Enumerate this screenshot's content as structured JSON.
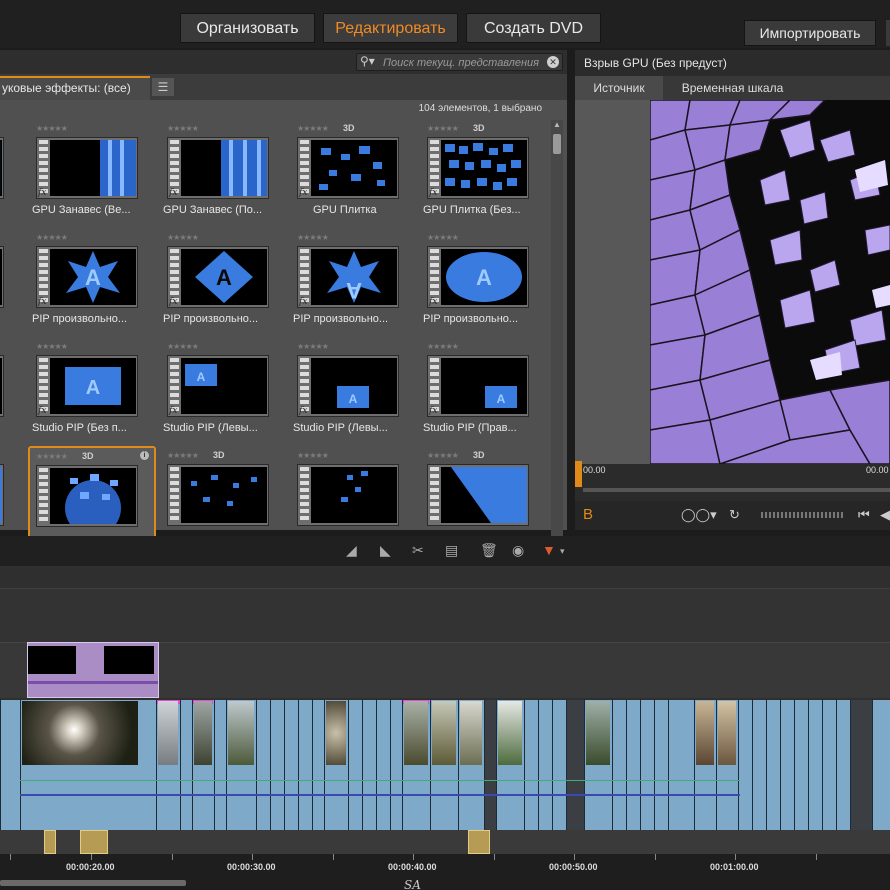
{
  "modes": [
    {
      "label": "Организовать"
    },
    {
      "label": "Редактировать"
    },
    {
      "label": "Создать DVD"
    }
  ],
  "import_label": "Импортировать",
  "library": {
    "search_placeholder": "Поиск текущ. представления",
    "tab_label": "уковые эффекты: (все)",
    "count_text": "104 элементов, 1 выбрано",
    "badge_3d": "3D",
    "tiles": [
      {
        "label": "GPU Занавес (Ве..."
      },
      {
        "label": "GPU Занавес (По..."
      },
      {
        "label": "GPU Плитка"
      },
      {
        "label": "GPU Плитка (Без..."
      },
      {
        "label": "PIP произвольно..."
      },
      {
        "label": "PIP произвольно..."
      },
      {
        "label": "PIP произвольно..."
      },
      {
        "label": "PIP произвольно..."
      },
      {
        "label": "Studio PIP (Без п..."
      },
      {
        "label": "Studio PIP (Левы..."
      },
      {
        "label": "Studio PIP (Левы..."
      },
      {
        "label": "Studio PIP (Прав..."
      }
    ],
    "thumb_letter": "A"
  },
  "player": {
    "title": "Взрыв GPU (Без предуст)",
    "tabs": [
      "Источник",
      "Временная шкала"
    ],
    "timecode_left": "00.00",
    "timecode_right": "00.00",
    "mark_label": "B"
  },
  "ruler": {
    "labels": [
      "00:00:20.00",
      "00:00:30.00",
      "00:00:40.00",
      "00:00:50.00",
      "00:01:00.00"
    ],
    "sa_text": "SA"
  },
  "colors": {
    "accent": "#f08a24",
    "clip_blue": "#7fa9c8",
    "title_clip": "#a98dc4",
    "audio_clip": "#b59b53"
  }
}
